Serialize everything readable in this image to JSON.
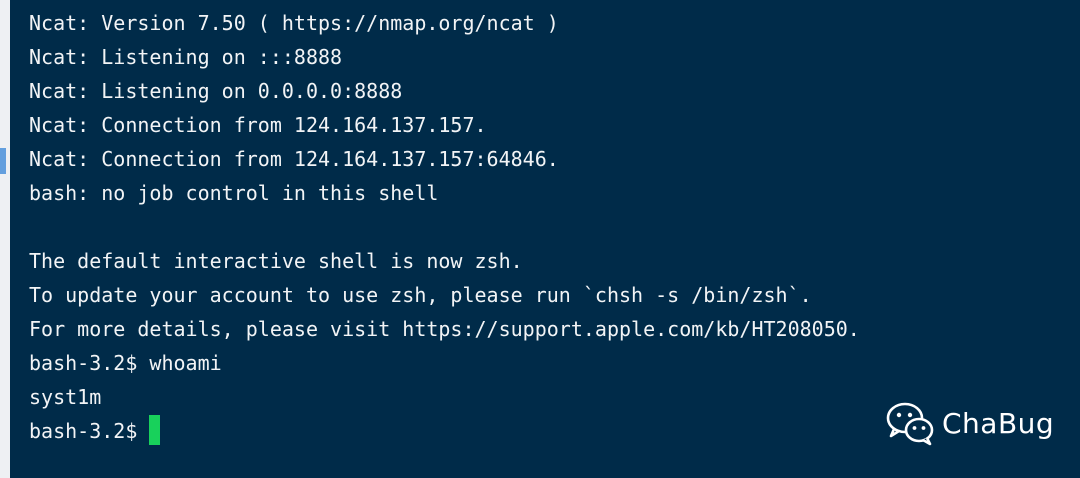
{
  "terminal": {
    "lines": [
      "Ncat: Version 7.50 ( https://nmap.org/ncat )",
      "Ncat: Listening on :::8888",
      "Ncat: Listening on 0.0.0.0:8888",
      "Ncat: Connection from 124.164.137.157.",
      "Ncat: Connection from 124.164.137.157:64846.",
      "bash: no job control in this shell",
      "",
      "The default interactive shell is now zsh.",
      "To update your account to use zsh, please run `chsh -s /bin/zsh`.",
      "For more details, please visit https://support.apple.com/kb/HT208050.",
      "bash-3.2$ whoami",
      "syst1m"
    ],
    "prompt": "bash-3.2$",
    "colors": {
      "background": "#002b49",
      "text": "#f2f4f6",
      "cursor": "#18d15b"
    }
  },
  "watermark": {
    "icon": "wechat-icon",
    "label": "ChaBug"
  }
}
